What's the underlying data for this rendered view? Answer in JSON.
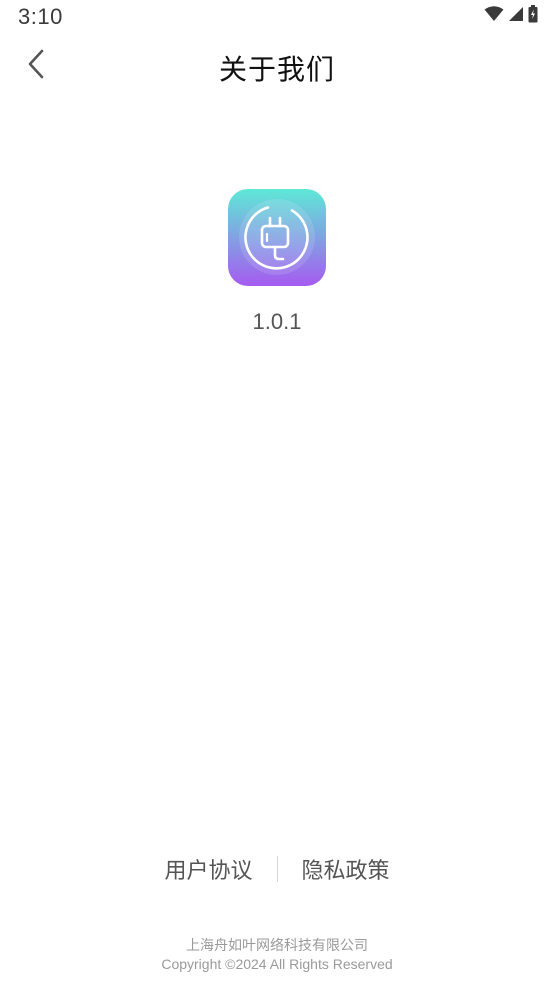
{
  "status_bar": {
    "time": "3:10",
    "icons": [
      "wifi-icon",
      "cellular-signal-icon",
      "battery-charging-icon"
    ]
  },
  "header": {
    "title": "关于我们",
    "back_icon": "chevron-left-icon"
  },
  "app": {
    "icon": "power-plug-icon",
    "version": "1.0.1"
  },
  "footer": {
    "links": {
      "user_agreement": "用户协议",
      "privacy_policy": "隐私政策"
    },
    "company": "上海舟如叶网络科技有限公司",
    "copyright": "Copyright ©2024 All Rights Reserved"
  },
  "colors": {
    "icon_gradient_top": "#5ee8d6",
    "icon_gradient_bottom": "#a55bf0",
    "text_secondary": "#555555",
    "text_muted": "#9a9a9a"
  }
}
